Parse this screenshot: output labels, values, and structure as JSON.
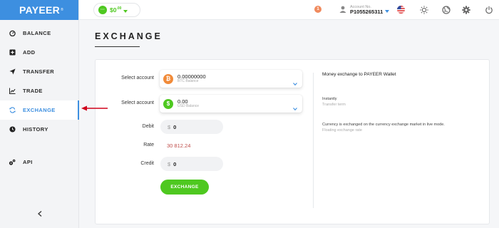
{
  "brand": {
    "logo": "PAYEER",
    "mark": "®"
  },
  "sidebar": {
    "items": [
      {
        "label": "BALANCE",
        "icon": "gauge-icon"
      },
      {
        "label": "ADD",
        "icon": "plus-square-icon"
      },
      {
        "label": "TRANSFER",
        "icon": "paper-plane-icon"
      },
      {
        "label": "TRADE",
        "icon": "chart-icon"
      },
      {
        "label": "EXCHANGE",
        "icon": "refresh-icon",
        "active": true
      },
      {
        "label": "HISTORY",
        "icon": "clock-icon"
      },
      {
        "label": "API",
        "icon": "gears-icon"
      }
    ],
    "collapse_icon": "chevron-left-icon"
  },
  "topbar": {
    "balance": {
      "amount": "$0",
      "cents": ".00",
      "coin_glyph": "···"
    },
    "notifications": "1",
    "account": {
      "label": "Account No.",
      "number": "P1055265311"
    }
  },
  "page": {
    "title": "EXCHANGE"
  },
  "exchange": {
    "from": {
      "label": "Select account",
      "value": "0.00000000",
      "sub": "BTC Balance",
      "glyph": "₿"
    },
    "to": {
      "label": "Select account",
      "value": "0.00",
      "sub": "USD Balance",
      "glyph": "$"
    },
    "debit": {
      "label": "Debit",
      "currency": "$",
      "value": "0"
    },
    "rate": {
      "label": "Rate",
      "value": "30 812.24"
    },
    "credit": {
      "label": "Credit",
      "currency": "$",
      "value": "0"
    },
    "button": "EXCHANGE"
  },
  "info": {
    "title": "Money exchange to PAYEER Wallet",
    "transfer_term": "Instantly",
    "transfer_term_label": "Transfer term",
    "rate_note": "Currency is exchanged on the currency exchange market in live mode.",
    "rate_note_label": "Floating exchange rate"
  },
  "colors": {
    "accent": "#3d8fe0",
    "green": "#4ec820",
    "btc": "#f18b3a",
    "rate": "#c0504d",
    "arrow": "#d0021b"
  }
}
